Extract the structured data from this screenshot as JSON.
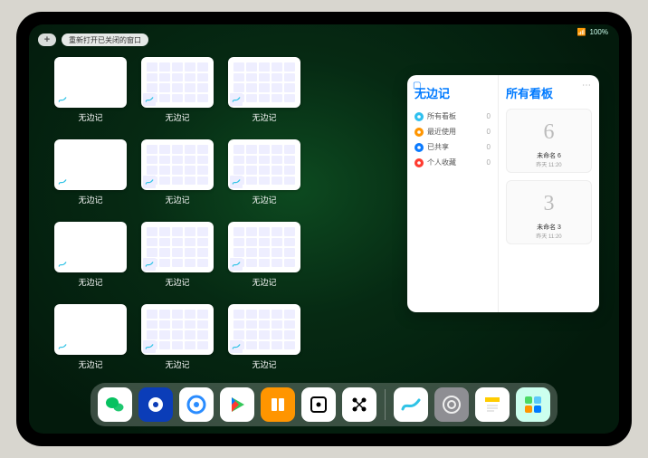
{
  "status": {
    "wifi": "📶",
    "battery": "100%"
  },
  "topbar": {
    "plus": "+",
    "reopen": "重新打开已关闭的窗口"
  },
  "app_label": "无边记",
  "tiles": [
    {
      "kind": "blank"
    },
    {
      "kind": "cal"
    },
    {
      "kind": "cal"
    },
    {
      "kind": "blank"
    },
    {
      "kind": "cal"
    },
    {
      "kind": "cal"
    },
    {
      "kind": "blank"
    },
    {
      "kind": "cal"
    },
    {
      "kind": "cal"
    },
    {
      "kind": "blank"
    },
    {
      "kind": "cal"
    },
    {
      "kind": "cal"
    }
  ],
  "popover": {
    "left_title": "无边记",
    "right_title": "所有看板",
    "items": [
      {
        "label": "所有看板",
        "count": "0",
        "color": "#2fc0ef"
      },
      {
        "label": "最近使用",
        "count": "0",
        "color": "#ff9500"
      },
      {
        "label": "已共享",
        "count": "0",
        "color": "#0a7aff"
      },
      {
        "label": "个人收藏",
        "count": "0",
        "color": "#ff3b30"
      }
    ],
    "boards": [
      {
        "glyph": "6",
        "label": "未命名 6",
        "time": "昨天 11:20"
      },
      {
        "glyph": "3",
        "label": "未命名 3",
        "time": "昨天 11:20"
      }
    ]
  },
  "dock": [
    {
      "name": "wechat",
      "bg": "#fff",
      "fg": "#07c160"
    },
    {
      "name": "quark",
      "bg": "#0b3db8",
      "fg": "#fff"
    },
    {
      "name": "qqbrowser",
      "bg": "#fff",
      "fg": "#2a8cff"
    },
    {
      "name": "play",
      "bg": "#fff",
      "fg": "#34c759"
    },
    {
      "name": "books",
      "bg": "#ff9500",
      "fg": "#fff"
    },
    {
      "name": "dice",
      "bg": "#fff",
      "fg": "#000"
    },
    {
      "name": "dots",
      "bg": "#fff",
      "fg": "#000"
    },
    {
      "name": "freeform",
      "bg": "#fff",
      "fg": "#30c3e6"
    },
    {
      "name": "settings",
      "bg": "#8e8e93",
      "fg": "#eee"
    },
    {
      "name": "notes",
      "bg": "#fff",
      "fg": "#ffcc00"
    },
    {
      "name": "apps",
      "bg": "#cfe",
      "fg": "#888"
    }
  ]
}
